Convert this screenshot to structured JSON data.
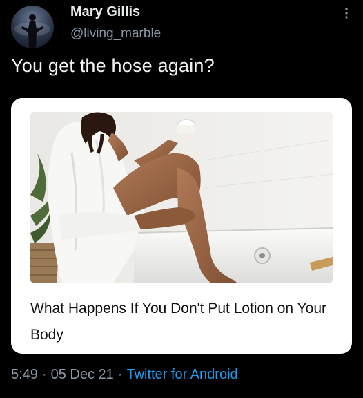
{
  "tweet": {
    "author": {
      "display_name": "Mary Gillis",
      "handle": "@living_marble",
      "avatar_icon": "avatar-silhouette"
    },
    "menu_icon": "more-vertical-icon",
    "text": "You get the hose again?",
    "card": {
      "title": "What Happens If You Don't Put Lotion on Your Body",
      "image_subject": "woman in white bathrobe applying lotion to her leg beside a bathtub"
    },
    "meta": {
      "time": "5:49",
      "separator": "·",
      "date": "05 Dec 21",
      "source": "Twitter for Android"
    }
  },
  "colors": {
    "background": "#000000",
    "text_primary": "#e7e9ea",
    "text_secondary": "#8b98a5",
    "accent": "#1d9bf0",
    "card_background": "#ffffff"
  }
}
